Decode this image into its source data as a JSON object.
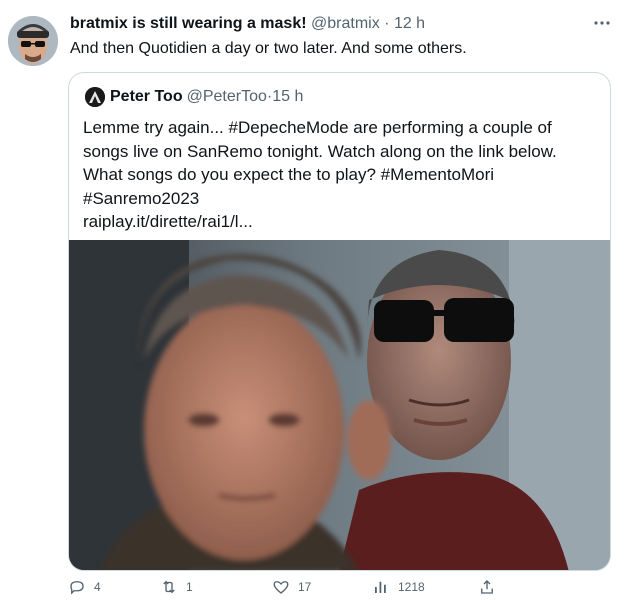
{
  "tweet": {
    "display_name": "bratmix is still wearing a mask!",
    "handle": "@bratmix",
    "separator": "·",
    "time": "12 h",
    "text": "And then Quotidien a day or two later. And some others."
  },
  "quote": {
    "display_name": "Peter Too",
    "handle": "@PeterToo",
    "separator": "·",
    "time": "15 h",
    "lines": [
      "Lemme try again... #DepecheMode are performing a couple of",
      "songs live on SanRemo tonight. Watch along on the link below.",
      "What songs do you expect the to play? #MementoMori",
      "#Sanremo2023",
      "raiplay.it/dirette/rai1/l..."
    ]
  },
  "actions": {
    "replies": "4",
    "retweets": "1",
    "likes": "17",
    "views": "1218"
  },
  "icons": [
    "more-icon",
    "reply-icon",
    "retweet-icon",
    "like-icon",
    "views-icon",
    "share-icon"
  ],
  "colors": {
    "secondary_text": "#536471",
    "border": "#cfd9de",
    "text": "#0f1419"
  }
}
